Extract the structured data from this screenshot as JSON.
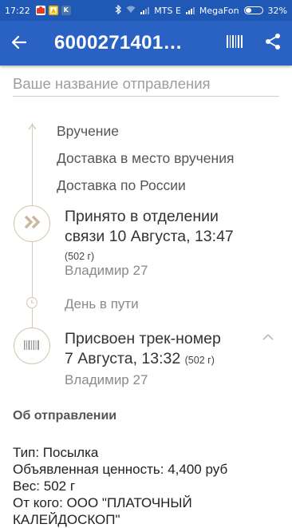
{
  "status_bar": {
    "time": "17:22",
    "carrier1": "MTS E",
    "carrier2": "MegaFon",
    "battery": "32%",
    "notification_icons": [
      "mail-app-icon",
      "mail-app-icon-2",
      "vk-icon"
    ]
  },
  "app_bar": {
    "title": "6000271401…",
    "back_icon": "arrow-left-icon",
    "actions": [
      "barcode-icon",
      "share-icon"
    ]
  },
  "name_field": {
    "placeholder": "Ваше название отправления"
  },
  "stages": [
    "Вручение",
    "Доставка в место вручения",
    "Доставка по России"
  ],
  "events": [
    {
      "icon": "double-chevron-right-icon",
      "title_line1": "Принято в отделении",
      "title_line2": "связи 10 Августа, 13:47",
      "weight": "(502 г)",
      "place": "Владимир 27"
    },
    {
      "icon": "barcode-icon",
      "title_line1": "Присвоен трек-номер",
      "title_line2": "7 Августа, 13:32",
      "weight": "(502 г)",
      "place": "Владимир 27"
    }
  ],
  "day_in_transit": "День в пути",
  "about": {
    "title": "Об отправлении",
    "lines": [
      "Тип: Посылка",
      "Объявленная ценность: 4,400 руб",
      "Вес: 502 г",
      "От кого: ООО \"ПЛАТОЧНЫЙ",
      "КАЛЕЙДОСКОП\""
    ]
  },
  "colors": {
    "status_bar": "#1f58b5",
    "app_bar": "#2a62c4",
    "timeline": "#d6c5b0"
  }
}
